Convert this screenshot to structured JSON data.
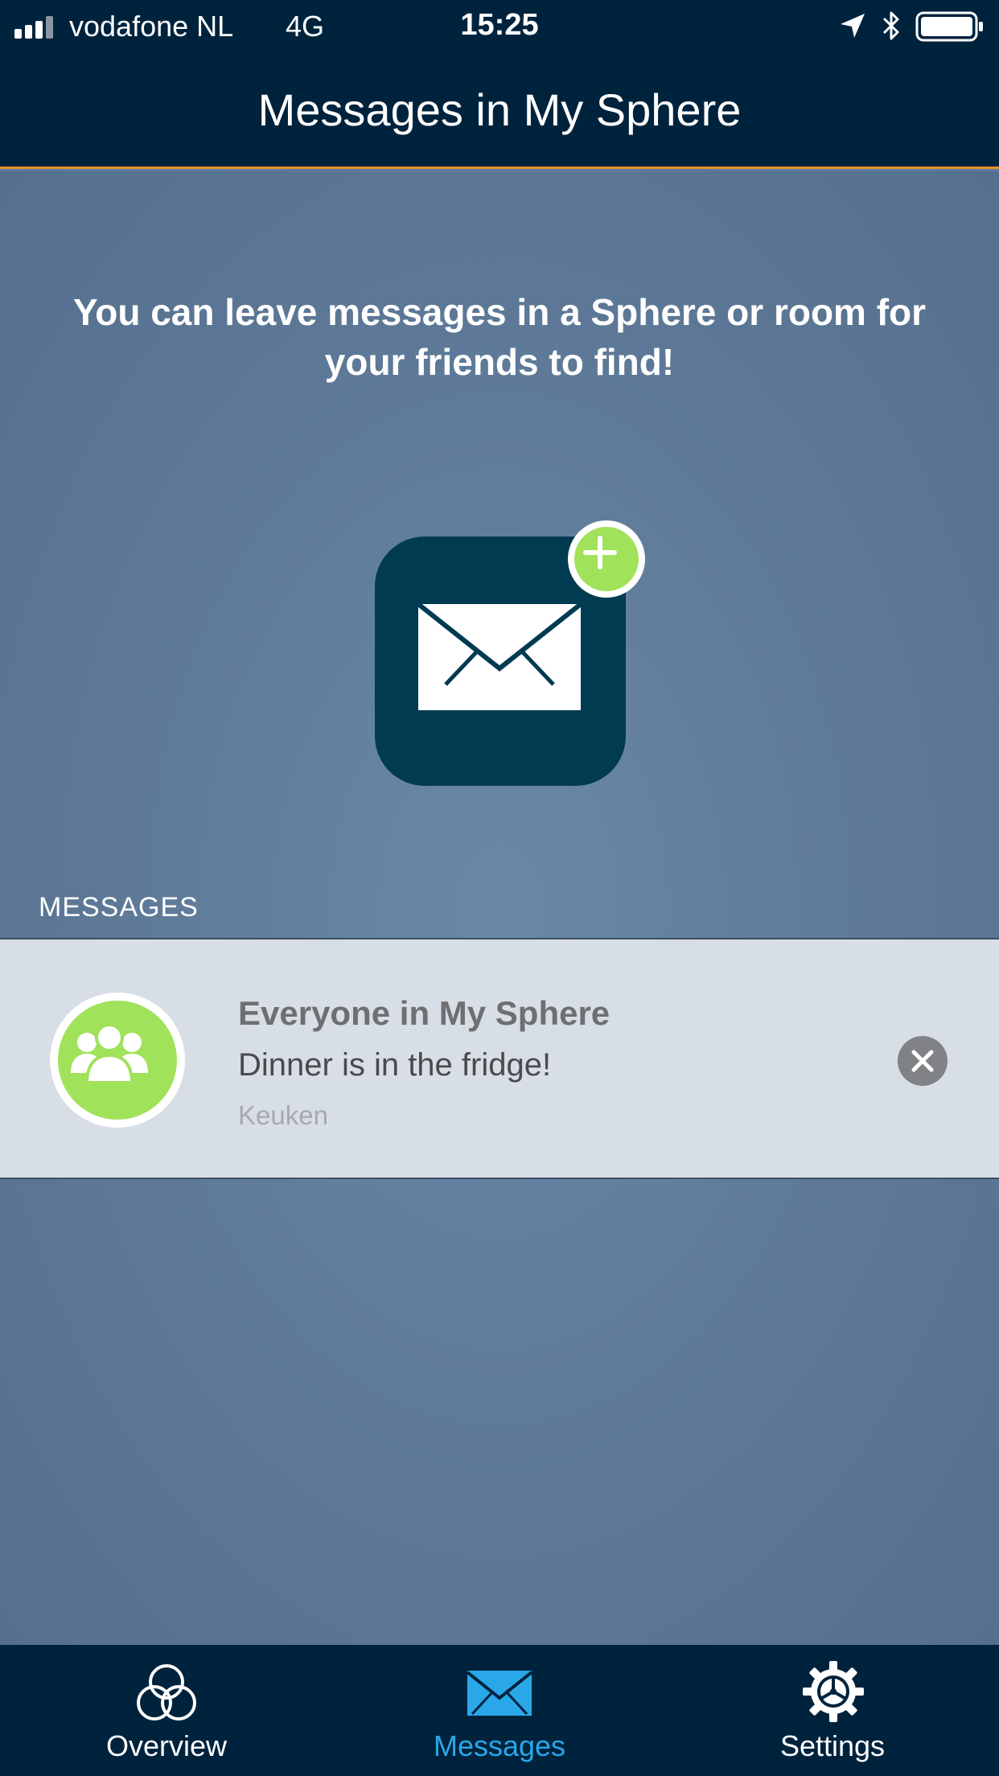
{
  "status_bar": {
    "carrier": "vodafone NL",
    "network": "4G",
    "time": "15:25",
    "icons": [
      "signal-icon",
      "location-arrow-icon",
      "bluetooth-icon",
      "battery-icon"
    ]
  },
  "nav": {
    "title": "Messages in My Sphere"
  },
  "intro": {
    "text": "You can leave messages in a Sphere or room for your friends to find!"
  },
  "add_button": {
    "icon": "envelope-icon",
    "badge_icon": "plus-icon"
  },
  "messages_section": {
    "header": "MESSAGES",
    "items": [
      {
        "recipient": "Everyone in My Sphere",
        "body": "Dinner is in the fridge!",
        "location": "Keuken",
        "avatar_icon": "group-icon",
        "action_icon": "close-icon"
      }
    ]
  },
  "tabs": [
    {
      "label": "Overview",
      "icon": "spheres-icon",
      "active": false
    },
    {
      "label": "Messages",
      "icon": "envelope-icon",
      "active": true
    },
    {
      "label": "Settings",
      "icon": "gear-icon",
      "active": false
    }
  ],
  "colors": {
    "bar_background": "#00233d",
    "accent_line": "#e8912a",
    "content_background": "#5f7c9b",
    "badge_green": "#a0e25a",
    "tile": "#003b52",
    "active_tab": "#2aa7e8",
    "row_background": "#d7dee6"
  }
}
